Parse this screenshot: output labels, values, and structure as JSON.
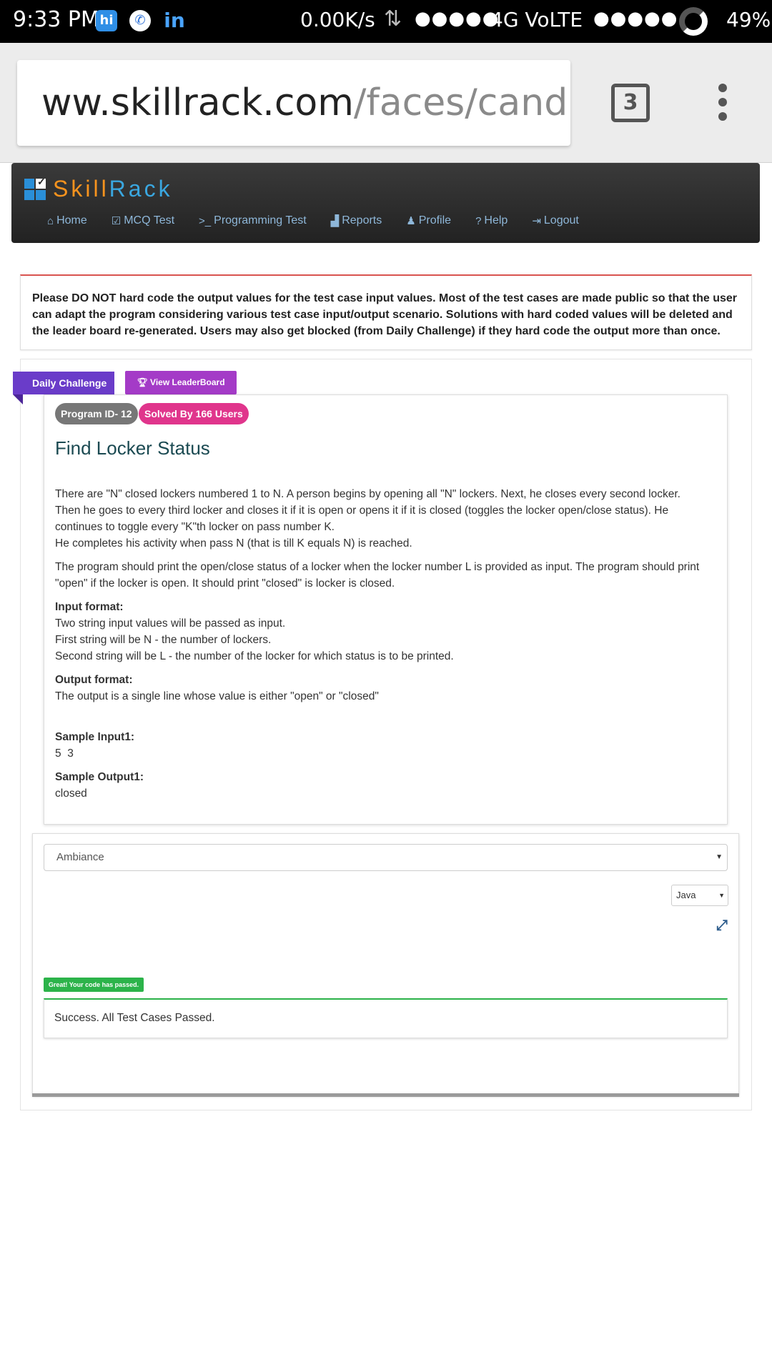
{
  "status_bar": {
    "time": "9:33 PM",
    "speed": "0.00K/s",
    "signal_left": "●●●●●",
    "network": "4G VoLTE",
    "signal_right": "●●●●●",
    "battery": "49%",
    "hi_label": "hi",
    "phone_icon_glyph": "✆",
    "linkedin_label": "in",
    "arrows_glyph": "⇅"
  },
  "browser": {
    "url_host": "ww.skillrack.com",
    "url_path": "/faces/candida",
    "tab_count": "3"
  },
  "site": {
    "logo_part1": "Skill",
    "logo_part2": "Rack",
    "nav": [
      {
        "label": "Home",
        "icon": "home-icon",
        "glyph": "⌂"
      },
      {
        "label": "MCQ Test",
        "icon": "check-square-icon",
        "glyph": "☑"
      },
      {
        "label": "Programming Test",
        "icon": "terminal-icon",
        "glyph": ">_"
      },
      {
        "label": "Reports",
        "icon": "signal-bars-icon",
        "glyph": "▟"
      },
      {
        "label": "Profile",
        "icon": "user-icon",
        "glyph": "♟"
      },
      {
        "label": "Help",
        "icon": "question-circle-icon",
        "glyph": "?"
      },
      {
        "label": "Logout",
        "icon": "logout-icon",
        "glyph": "⇥"
      }
    ]
  },
  "notice": {
    "text": "Please DO NOT hard code the output values for the test case input values. Most of the test cases are made public so that the user can adapt the program considering various test case input/output scenario. Solutions with hard coded values will be deleted and the leader board re-generated. Users may also get blocked (from Daily Challenge) if they hard code the output more than once."
  },
  "challenge": {
    "ribbon_label": "Daily Challenge",
    "leaderboard_label": "View LeaderBoard",
    "program_id": "Program ID- 12",
    "solved_by": "Solved By 166 Users",
    "title": "Find Locker Status",
    "description": [
      "There are \"N\" closed lockers numbered 1 to N. A person begins by opening all \"N\" lockers. Next, he closes every second locker.",
      "Then he goes to every third locker and closes it if it is open or opens it if it is closed (toggles the locker open/close status). He",
      "continues to toggle every \"K\"th locker on pass number K.",
      "He completes his activity when pass N (that is till K equals N) is reached."
    ],
    "description2": "The program should print the open/close status of a locker when the locker number L is provided as input. The program should print \"open\" if the locker is open. It should print \"closed\" is locker is closed.",
    "input_format_label": "Input format:",
    "input_format_lines": [
      "Two string input values will be passed as input.",
      "First string will be N - the number of lockers.",
      "Second string will be L - the number of the locker for which status is to be printed."
    ],
    "output_format_label": "Output format:",
    "output_format_text": "The output is a single line whose value is either \"open\" or \"closed\"",
    "sample_input_label": "Sample Input1:",
    "sample_input_value": "5  3",
    "sample_output_label": "Sample Output1:",
    "sample_output_value": "closed"
  },
  "editor": {
    "theme": "Ambiance",
    "language": "Java",
    "pass_badge": "Great! Your code has passed.",
    "result": "Success. All Test Cases Passed."
  },
  "colors": {
    "ribbon": "#6a3cc9",
    "leaderboard": "#a43bc7",
    "solved_badge": "#e0358c",
    "success": "#2cb34a",
    "notice_border": "#d9534f"
  }
}
